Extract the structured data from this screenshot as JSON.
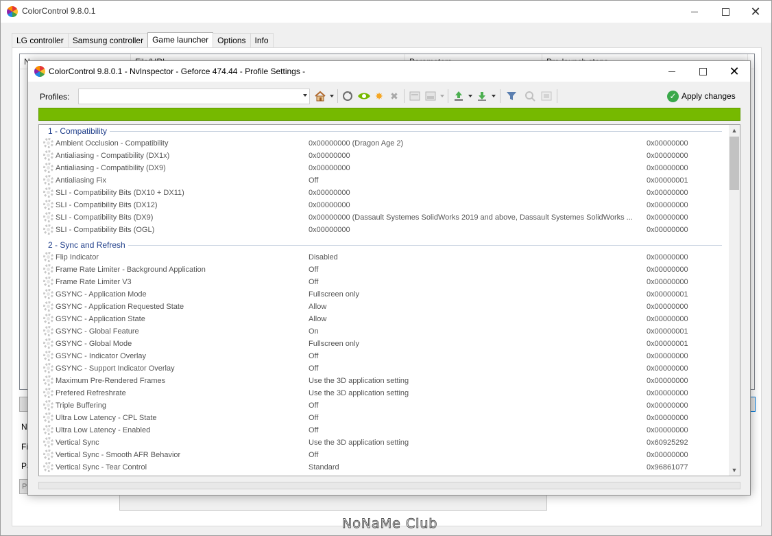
{
  "main_window": {
    "title": "ColorControl 9.8.0.1",
    "tabs": [
      "LG controller",
      "Samsung controller",
      "Game launcher",
      "Options",
      "Info"
    ],
    "active_tab": 2,
    "list_headers": [
      "N",
      "File/URL",
      "Parameters",
      "Pre-launch steps"
    ],
    "side_labels": [
      "Na",
      "Fi",
      "Pa"
    ],
    "button_stub": "P"
  },
  "nv_window": {
    "title": "ColorControl 9.8.0.1 - NvInspector - Geforce 474.44 - Profile Settings -",
    "profiles_label": "Profiles:",
    "profiles_value": "",
    "apply_label": "Apply changes",
    "toolbar_icons": [
      "home-icon",
      "refresh-icon",
      "nvidia-icon",
      "sun-icon",
      "delete-icon",
      "add-profile-icon",
      "export-icon",
      "import-icon",
      "download-icon",
      "filter-icon",
      "scan-icon",
      "settings-icon"
    ],
    "accent_color": "#76b900"
  },
  "groups": [
    {
      "title": "1 - Compatibility",
      "rows": [
        {
          "name": "Ambient Occlusion - Compatibility",
          "value": "0x00000000 (Dragon Age 2)",
          "hex": "0x00000000"
        },
        {
          "name": "Antialiasing - Compatibility (DX1x)",
          "value": "0x00000000",
          "hex": "0x00000000"
        },
        {
          "name": "Antialiasing - Compatibility (DX9)",
          "value": "0x00000000",
          "hex": "0x00000000"
        },
        {
          "name": "Antialiasing Fix",
          "value": "Off",
          "hex": "0x00000001"
        },
        {
          "name": "SLI - Compatibility Bits (DX10 + DX11)",
          "value": "0x00000000",
          "hex": "0x00000000"
        },
        {
          "name": "SLI - Compatibility Bits (DX12)",
          "value": "0x00000000",
          "hex": "0x00000000"
        },
        {
          "name": "SLI - Compatibility Bits (DX9)",
          "value": "0x00000000 (Dassault Systemes SolidWorks 2019 and above, Dassault Systemes SolidWorks ...",
          "hex": "0x00000000"
        },
        {
          "name": "SLI - Compatibility Bits (OGL)",
          "value": "0x00000000",
          "hex": "0x00000000"
        }
      ]
    },
    {
      "title": "2 - Sync and Refresh",
      "rows": [
        {
          "name": "Flip Indicator",
          "value": "Disabled",
          "hex": "0x00000000"
        },
        {
          "name": "Frame Rate Limiter - Background Application",
          "value": "Off",
          "hex": "0x00000000"
        },
        {
          "name": "Frame Rate Limiter V3",
          "value": "Off",
          "hex": "0x00000000"
        },
        {
          "name": "GSYNC - Application Mode",
          "value": "Fullscreen only",
          "hex": "0x00000001"
        },
        {
          "name": "GSYNC - Application Requested State",
          "value": "Allow",
          "hex": "0x00000000"
        },
        {
          "name": "GSYNC - Application State",
          "value": "Allow",
          "hex": "0x00000000"
        },
        {
          "name": "GSYNC - Global Feature",
          "value": "On",
          "hex": "0x00000001"
        },
        {
          "name": "GSYNC - Global Mode",
          "value": "Fullscreen only",
          "hex": "0x00000001"
        },
        {
          "name": "GSYNC - Indicator Overlay",
          "value": "Off",
          "hex": "0x00000000"
        },
        {
          "name": "GSYNC - Support Indicator Overlay",
          "value": "Off",
          "hex": "0x00000000"
        },
        {
          "name": "Maximum Pre-Rendered Frames",
          "value": "Use the 3D application setting",
          "hex": "0x00000000"
        },
        {
          "name": "Prefered Refreshrate",
          "value": "Use the 3D application setting",
          "hex": "0x00000000"
        },
        {
          "name": "Triple Buffering",
          "value": "Off",
          "hex": "0x00000000"
        },
        {
          "name": "Ultra Low Latency - CPL State",
          "value": "Off",
          "hex": "0x00000000"
        },
        {
          "name": "Ultra Low Latency - Enabled",
          "value": "Off",
          "hex": "0x00000000"
        },
        {
          "name": "Vertical Sync",
          "value": "Use the 3D application setting",
          "hex": "0x60925292"
        },
        {
          "name": "Vertical Sync - Smooth AFR Behavior",
          "value": "Off",
          "hex": "0x00000000"
        },
        {
          "name": "Vertical Sync - Tear Control",
          "value": "Standard",
          "hex": "0x96861077"
        }
      ]
    }
  ],
  "watermark": "NoNaMe Club"
}
